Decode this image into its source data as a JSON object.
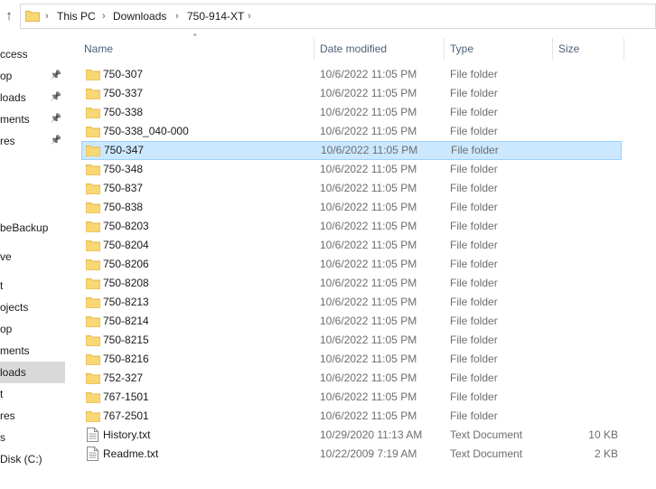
{
  "address": {
    "crumbs": [
      "This PC",
      "Downloads",
      "750-914-XT"
    ]
  },
  "nav": {
    "items": [
      {
        "label": "ccess",
        "pinned": false,
        "selected": false
      },
      {
        "label": "op",
        "pinned": true,
        "selected": false
      },
      {
        "label": "loads",
        "pinned": true,
        "selected": false
      },
      {
        "label": "ments",
        "pinned": true,
        "selected": false
      },
      {
        "label": "res",
        "pinned": true,
        "selected": false
      },
      {
        "label": "beBackup",
        "pinned": false,
        "selected": false
      },
      {
        "label": "ve",
        "pinned": false,
        "selected": false
      },
      {
        "label": "t",
        "pinned": false,
        "selected": false
      },
      {
        "label": "ojects",
        "pinned": false,
        "selected": false
      },
      {
        "label": "op",
        "pinned": false,
        "selected": false
      },
      {
        "label": "ments",
        "pinned": false,
        "selected": false
      },
      {
        "label": "loads",
        "pinned": false,
        "selected": true
      },
      {
        "label": "t",
        "pinned": false,
        "selected": false
      },
      {
        "label": "res",
        "pinned": false,
        "selected": false
      },
      {
        "label": "s",
        "pinned": false,
        "selected": false
      },
      {
        "label": "Disk (C:)",
        "pinned": false,
        "selected": false
      }
    ]
  },
  "columns": {
    "name": "Name",
    "date": "Date modified",
    "type": "Type",
    "size": "Size"
  },
  "files": [
    {
      "name": "750-307",
      "date": "10/6/2022 11:05 PM",
      "type": "File folder",
      "size": "",
      "kind": "folder"
    },
    {
      "name": "750-337",
      "date": "10/6/2022 11:05 PM",
      "type": "File folder",
      "size": "",
      "kind": "folder"
    },
    {
      "name": "750-338",
      "date": "10/6/2022 11:05 PM",
      "type": "File folder",
      "size": "",
      "kind": "folder"
    },
    {
      "name": "750-338_040-000",
      "date": "10/6/2022 11:05 PM",
      "type": "File folder",
      "size": "",
      "kind": "folder"
    },
    {
      "name": "750-347",
      "date": "10/6/2022 11:05 PM",
      "type": "File folder",
      "size": "",
      "kind": "folder",
      "selected": true
    },
    {
      "name": "750-348",
      "date": "10/6/2022 11:05 PM",
      "type": "File folder",
      "size": "",
      "kind": "folder"
    },
    {
      "name": "750-837",
      "date": "10/6/2022 11:05 PM",
      "type": "File folder",
      "size": "",
      "kind": "folder"
    },
    {
      "name": "750-838",
      "date": "10/6/2022 11:05 PM",
      "type": "File folder",
      "size": "",
      "kind": "folder"
    },
    {
      "name": "750-8203",
      "date": "10/6/2022 11:05 PM",
      "type": "File folder",
      "size": "",
      "kind": "folder"
    },
    {
      "name": "750-8204",
      "date": "10/6/2022 11:05 PM",
      "type": "File folder",
      "size": "",
      "kind": "folder"
    },
    {
      "name": "750-8206",
      "date": "10/6/2022 11:05 PM",
      "type": "File folder",
      "size": "",
      "kind": "folder"
    },
    {
      "name": "750-8208",
      "date": "10/6/2022 11:05 PM",
      "type": "File folder",
      "size": "",
      "kind": "folder"
    },
    {
      "name": "750-8213",
      "date": "10/6/2022 11:05 PM",
      "type": "File folder",
      "size": "",
      "kind": "folder"
    },
    {
      "name": "750-8214",
      "date": "10/6/2022 11:05 PM",
      "type": "File folder",
      "size": "",
      "kind": "folder"
    },
    {
      "name": "750-8215",
      "date": "10/6/2022 11:05 PM",
      "type": "File folder",
      "size": "",
      "kind": "folder"
    },
    {
      "name": "750-8216",
      "date": "10/6/2022 11:05 PM",
      "type": "File folder",
      "size": "",
      "kind": "folder"
    },
    {
      "name": "752-327",
      "date": "10/6/2022 11:05 PM",
      "type": "File folder",
      "size": "",
      "kind": "folder"
    },
    {
      "name": "767-1501",
      "date": "10/6/2022 11:05 PM",
      "type": "File folder",
      "size": "",
      "kind": "folder"
    },
    {
      "name": "767-2501",
      "date": "10/6/2022 11:05 PM",
      "type": "File folder",
      "size": "",
      "kind": "folder"
    },
    {
      "name": "History.txt",
      "date": "10/29/2020 11:13 AM",
      "type": "Text Document",
      "size": "10 KB",
      "kind": "text"
    },
    {
      "name": "Readme.txt",
      "date": "10/22/2009 7:19 AM",
      "type": "Text Document",
      "size": "2 KB",
      "kind": "text"
    }
  ],
  "colors": {
    "folder": "#f8d775",
    "folder_dark": "#e3b748",
    "selection_bg": "#cce8ff",
    "selection_border": "#99d1ff",
    "nav_selected": "#d9d9d9"
  },
  "icons": {
    "up": "arrow-up-icon",
    "folder": "folder-icon",
    "text": "text-document-icon",
    "pin": "pin-icon",
    "sort": "sort-caret-icon"
  }
}
